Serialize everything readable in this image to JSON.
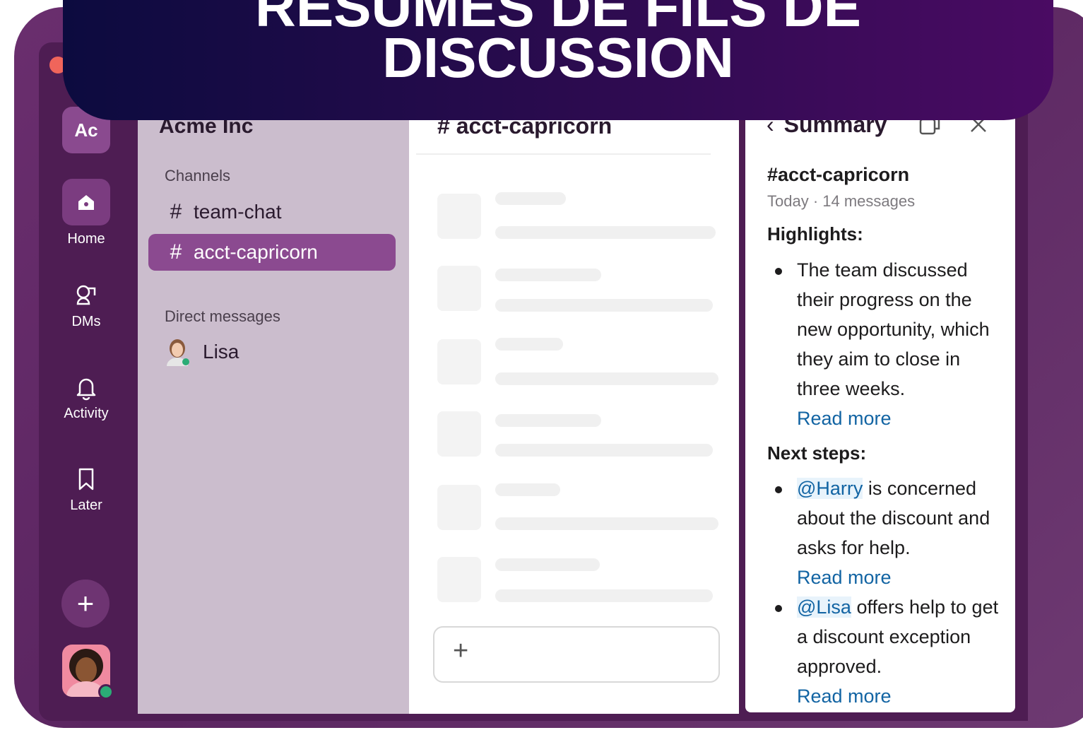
{
  "banner": {
    "line1": "RÉSUMÉS DE FILS DE",
    "line2": "DISCUSSION"
  },
  "rail": {
    "workspace_badge": "Ac",
    "home_label": "Home",
    "dms_label": "DMs",
    "activity_label": "Activity",
    "later_label": "Later",
    "add_symbol": "+"
  },
  "sidebar": {
    "workspace_name": "Acme Inc",
    "channels_heading": "Channels",
    "channels": [
      {
        "hash": "#",
        "name": "team-chat",
        "active": false
      },
      {
        "hash": "#",
        "name": "acct-capricorn",
        "active": true
      }
    ],
    "dm_heading": "Direct messages",
    "dms": [
      {
        "name": "Lisa"
      }
    ]
  },
  "main": {
    "channel_title": "# acct-capricorn",
    "composer_plus": "+"
  },
  "summary": {
    "title": "Summary",
    "channel": "#acct-capricorn",
    "meta": "Today · 14 messages",
    "highlights_heading": "Highlights:",
    "highlight_text": "The team discussed their progress on the new opportunity, which they aim to close in three weeks.",
    "read_more": "Read more",
    "next_heading": "Next steps:",
    "steps": [
      {
        "mention": "@Harry",
        "text": " is concerned about the discount and asks for help."
      },
      {
        "mention": "@Lisa",
        "text": " offers help to get a discount exception approved."
      }
    ]
  },
  "colors": {
    "aubergine": "#4e1d53",
    "active_channel": "#8b4a90",
    "link": "#1264a3",
    "presence": "#2bac76"
  }
}
